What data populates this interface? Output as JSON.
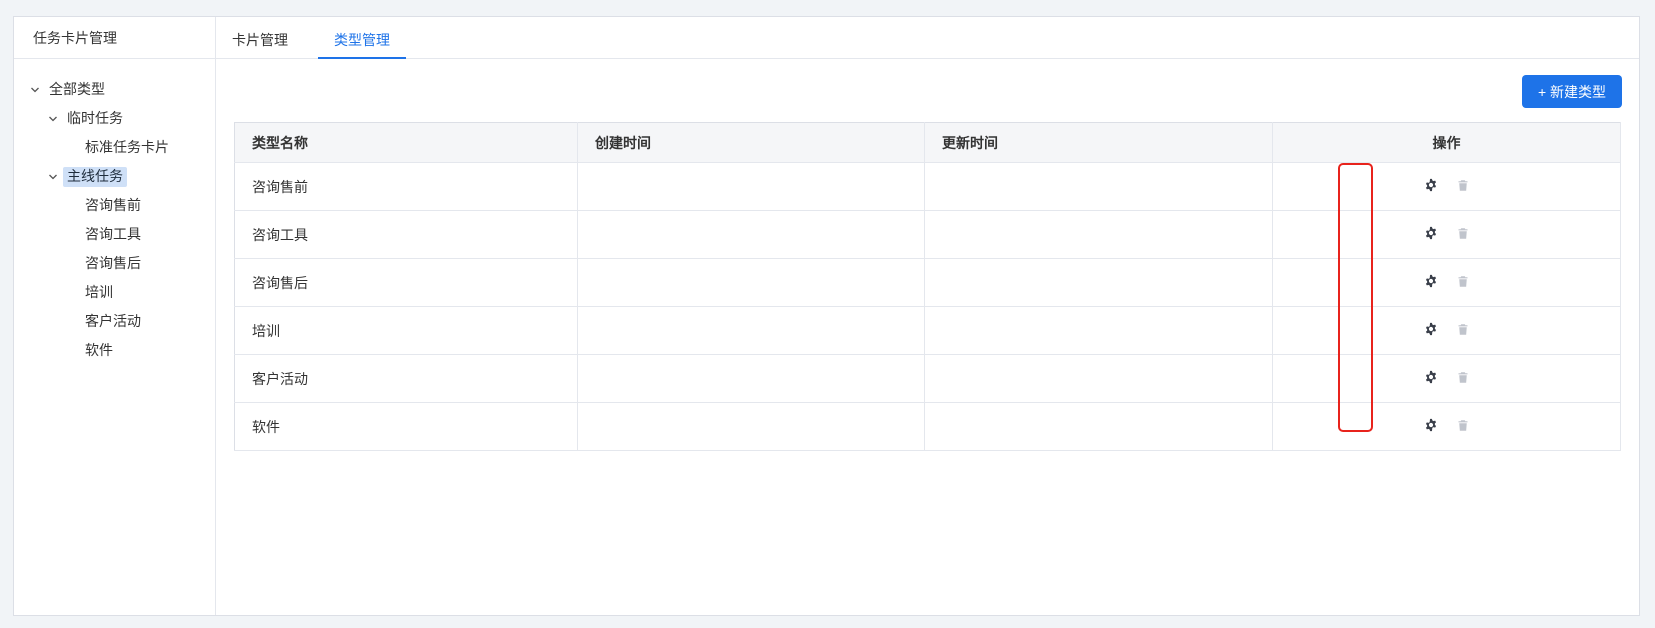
{
  "sidebar": {
    "title": "任务卡片管理",
    "tree": [
      {
        "label": "全部类型"
      },
      {
        "label": "临时任务"
      },
      {
        "label": "标准任务卡片"
      },
      {
        "label": "主线任务"
      },
      {
        "label": "咨询售前"
      },
      {
        "label": "咨询工具"
      },
      {
        "label": "咨询售后"
      },
      {
        "label": "培训"
      },
      {
        "label": "客户活动"
      },
      {
        "label": "软件"
      }
    ]
  },
  "tabs": [
    {
      "label": "卡片管理"
    },
    {
      "label": "类型管理"
    }
  ],
  "toolbar": {
    "new_type_label": "+ 新建类型"
  },
  "table": {
    "headers": [
      "类型名称",
      "创建时间",
      "更新时间",
      "操作"
    ],
    "rows": [
      {
        "name": "咨询售前",
        "created": "",
        "updated": ""
      },
      {
        "name": "咨询工具",
        "created": "",
        "updated": ""
      },
      {
        "name": "咨询售后",
        "created": "",
        "updated": ""
      },
      {
        "name": "培训",
        "created": "",
        "updated": ""
      },
      {
        "name": "客户活动",
        "created": "",
        "updated": ""
      },
      {
        "name": "软件",
        "created": "",
        "updated": ""
      }
    ]
  },
  "icons": {
    "settings": "gear-icon",
    "delete": "trash-icon",
    "expand": "chevron-down-icon"
  },
  "colors": {
    "accent": "#1e73e8",
    "highlight": "#e8231c",
    "selected_bg": "#cfe0f7"
  }
}
